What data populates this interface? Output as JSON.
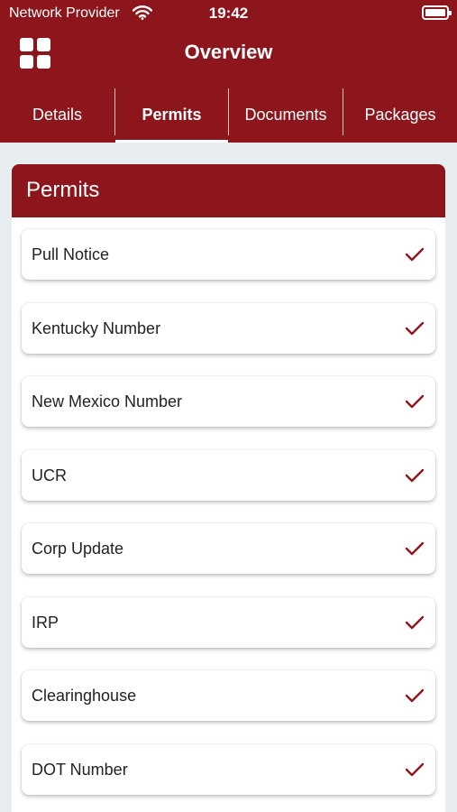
{
  "status_bar": {
    "carrier": "Network Provider",
    "time": "19:42",
    "wifi_icon": "wifi-icon",
    "battery_icon": "battery-full-icon"
  },
  "header": {
    "menu_icon": "grid-icon",
    "title": "Overview"
  },
  "tabs": [
    {
      "label": "Details",
      "active": false
    },
    {
      "label": "Permits",
      "active": true
    },
    {
      "label": "Documents",
      "active": false
    },
    {
      "label": "Packages",
      "active": false
    }
  ],
  "section": {
    "title": "Permits"
  },
  "permits": [
    {
      "label": "Pull Notice",
      "status_icon": "check-icon"
    },
    {
      "label": "Kentucky Number",
      "status_icon": "check-icon"
    },
    {
      "label": "New Mexico Number",
      "status_icon": "check-icon"
    },
    {
      "label": "UCR",
      "status_icon": "check-icon"
    },
    {
      "label": "Corp Update",
      "status_icon": "check-icon"
    },
    {
      "label": "IRP",
      "status_icon": "check-icon"
    },
    {
      "label": "Clearinghouse",
      "status_icon": "check-icon"
    },
    {
      "label": "DOT Number",
      "status_icon": "check-icon"
    }
  ],
  "colors": {
    "brand": "#8c161c",
    "background": "#e8edf2",
    "check": "#8c161c"
  }
}
